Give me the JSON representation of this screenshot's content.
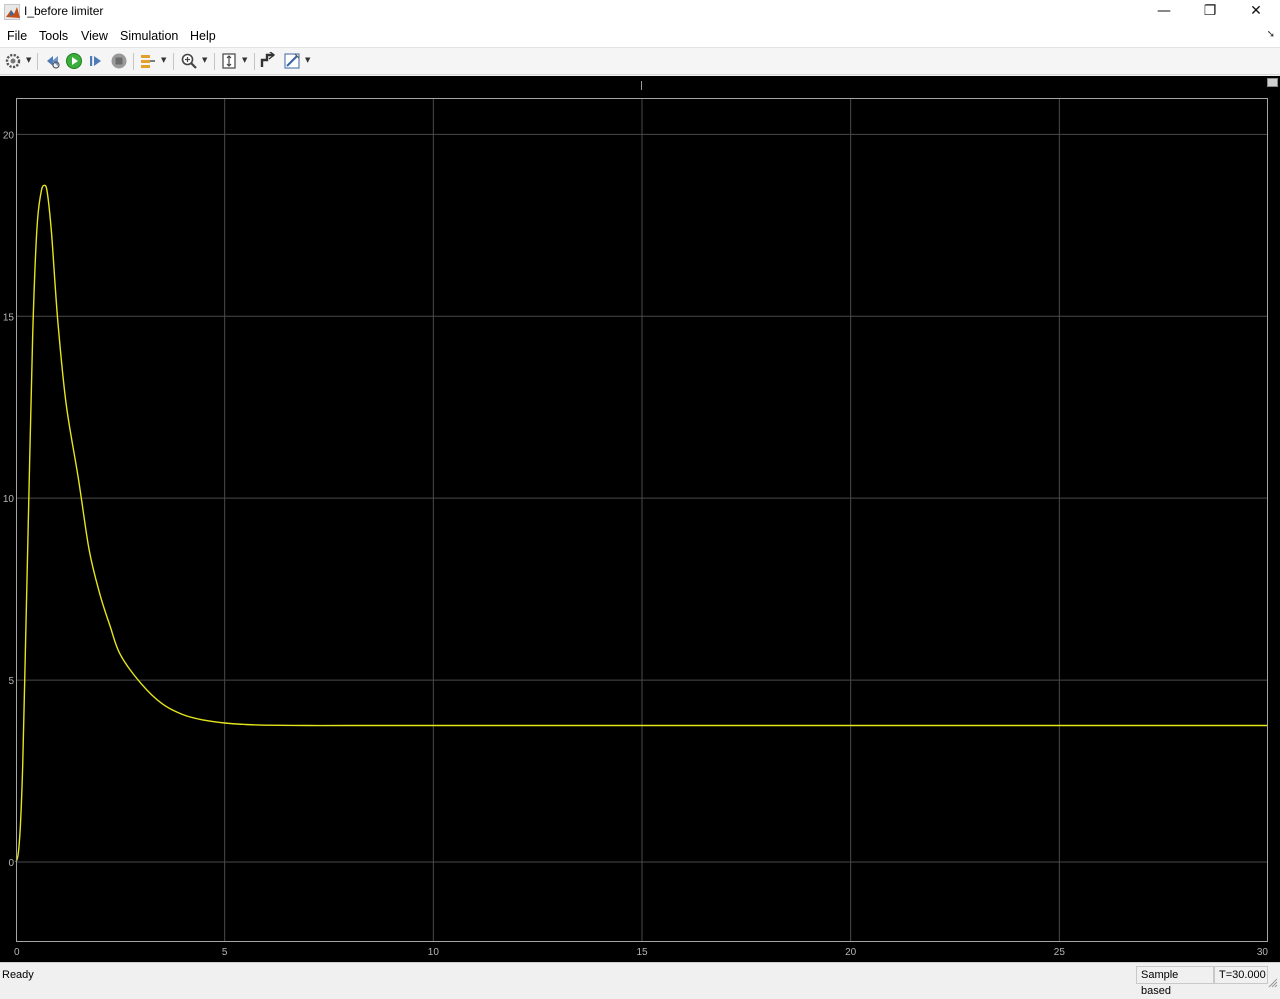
{
  "window": {
    "title": "I_before limiter",
    "minimize_glyph": "—",
    "restore_glyph": "❐",
    "close_glyph": "✕",
    "icon": "matlab-icon"
  },
  "menu": {
    "items": [
      "File",
      "Tools",
      "View",
      "Simulation",
      "Help"
    ],
    "pin_glyph": "➘"
  },
  "toolbar": {
    "buttons": [
      {
        "name": "settings-icon",
        "has_dropdown": true
      },
      {
        "name": "step-back-icon",
        "has_dropdown": false
      },
      {
        "name": "run-icon",
        "has_dropdown": false
      },
      {
        "name": "step-forward-icon",
        "has_dropdown": false
      },
      {
        "name": "stop-icon",
        "has_dropdown": false
      },
      {
        "name": "signal-highlight-icon",
        "has_dropdown": true
      },
      {
        "name": "zoom-icon",
        "has_dropdown": true
      },
      {
        "name": "scale-axes-icon",
        "has_dropdown": true
      },
      {
        "name": "triggers-icon",
        "has_dropdown": false
      },
      {
        "name": "measurements-icon",
        "has_dropdown": true
      }
    ],
    "dropdown_glyph": "▼"
  },
  "scope": {
    "background": "#000000",
    "grid_color": "#4a4a4a",
    "line_color": "#e5e51c",
    "tick_color": "#b5b5b5"
  },
  "chart_data": {
    "type": "line",
    "title": "",
    "xlabel": "",
    "ylabel": "",
    "xlim": [
      0,
      30
    ],
    "ylim": [
      -2.2,
      21
    ],
    "xticks": [
      0,
      5,
      10,
      15,
      20,
      25,
      30
    ],
    "yticks": [
      0,
      5,
      10,
      15,
      20
    ],
    "grid": true,
    "series": [
      {
        "x": [
          0,
          0.05,
          0.1,
          0.15,
          0.2,
          0.3,
          0.4,
          0.5,
          0.6,
          0.68,
          0.75,
          0.85,
          1.0,
          1.2,
          1.5,
          1.75,
          2.0,
          2.25,
          2.5,
          3.0,
          3.5,
          4.0,
          4.5,
          5.0,
          5.5,
          6.0,
          7.0,
          8.0,
          10.0,
          15.0,
          20.0,
          25.0,
          30.0
        ],
        "y": [
          0,
          0.2,
          0.9,
          2.3,
          4.5,
          9.6,
          14.5,
          17.4,
          18.4,
          18.6,
          18.4,
          17.3,
          14.9,
          12.6,
          10.5,
          8.6,
          7.4,
          6.5,
          5.7,
          4.9,
          4.35,
          4.05,
          3.9,
          3.82,
          3.78,
          3.76,
          3.75,
          3.75,
          3.75,
          3.75,
          3.75,
          3.75,
          3.75
        ]
      }
    ]
  },
  "status": {
    "text": "Ready",
    "sample_mode": "Sample based",
    "time": "T=30.000"
  }
}
